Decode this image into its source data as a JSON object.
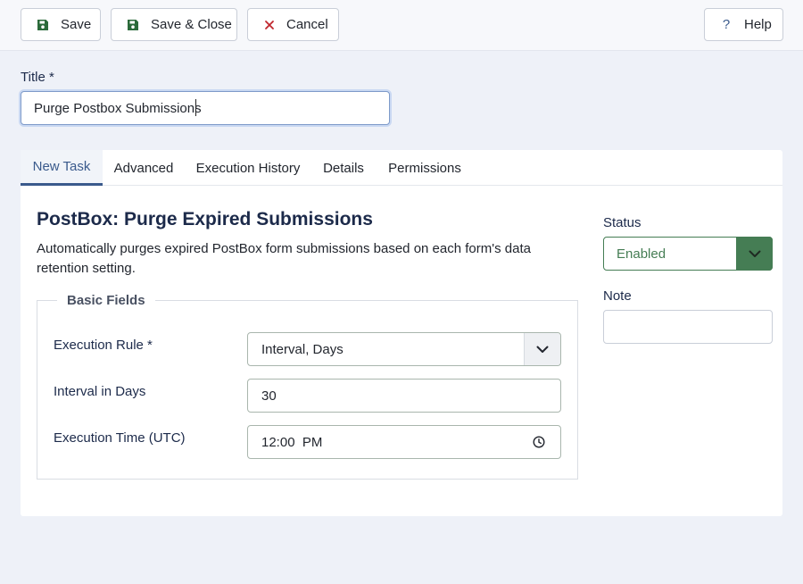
{
  "toolbar": {
    "save_label": "Save",
    "save_close_label": "Save & Close",
    "cancel_label": "Cancel",
    "help_label": "Help"
  },
  "title_field": {
    "label": "Title *",
    "value": "Purge Postbox Submissions"
  },
  "tabs": [
    {
      "label": "New Task",
      "active": true
    },
    {
      "label": "Advanced",
      "active": false
    },
    {
      "label": "Execution History",
      "active": false
    },
    {
      "label": "Details",
      "active": false
    },
    {
      "label": "Permissions",
      "active": false
    }
  ],
  "task": {
    "title": "PostBox: Purge Expired Submissions",
    "description": "Automatically purges expired PostBox form submissions based on each form's data retention setting."
  },
  "basic_fields": {
    "legend": "Basic Fields",
    "execution_rule": {
      "label": "Execution Rule *",
      "value": "Interval, Days"
    },
    "interval_days": {
      "label": "Interval in Days",
      "value": "30"
    },
    "execution_time": {
      "label": "Execution Time (UTC)",
      "value": "12:00  PM"
    }
  },
  "sidebar": {
    "status_label": "Status",
    "status_value": "Enabled",
    "note_label": "Note",
    "note_value": ""
  },
  "colors": {
    "save_icon": "#2b6a3a",
    "cancel_icon": "#c0262d",
    "help_icon": "#3a5a8c",
    "active_tab": "#3a5a8c",
    "status_green": "#457d54"
  }
}
